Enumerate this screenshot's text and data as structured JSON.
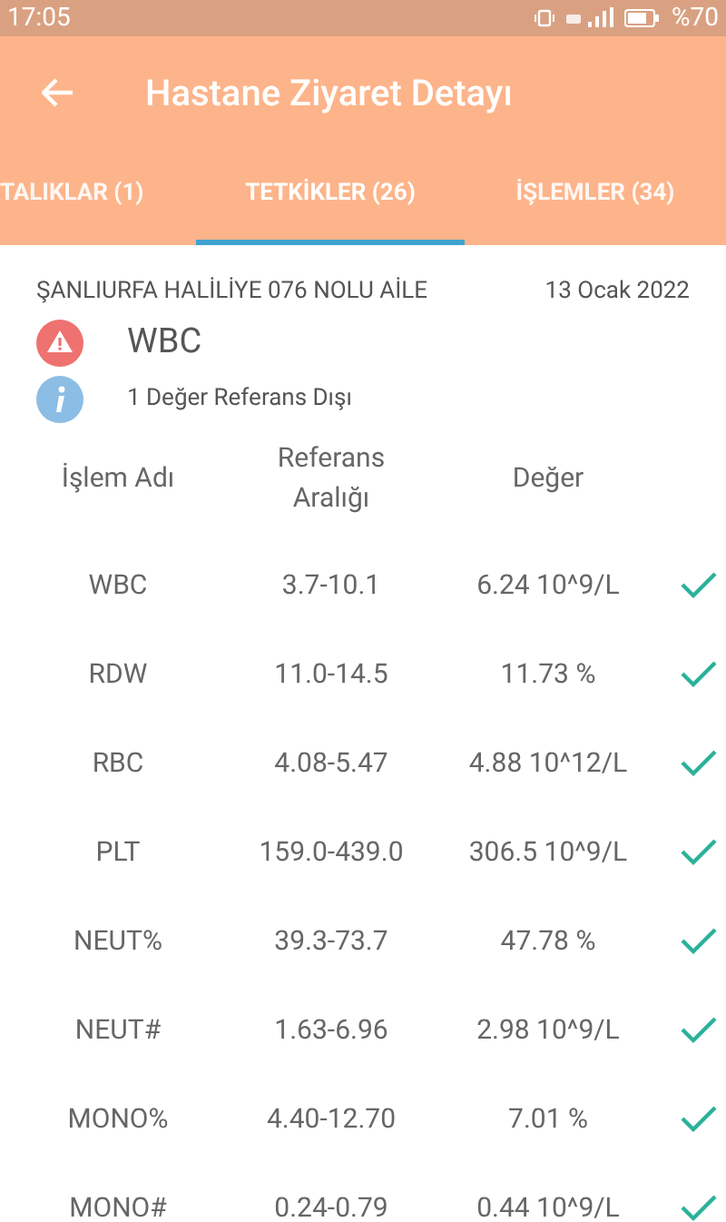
{
  "status_bar": {
    "time": "17:05",
    "battery": "%70"
  },
  "toolbar": {
    "title": "Hastane Ziyaret Detayı"
  },
  "tabs": [
    {
      "label": "TALIKLAR (1)",
      "selected": false
    },
    {
      "label": "TETKİKLER (26)",
      "selected": true
    },
    {
      "label": "İŞLEMLER (34)",
      "selected": false
    }
  ],
  "visit": {
    "facility": "ŞANLIURFA HALİLİYE 076 NOLU AİLE",
    "date": "13 Ocak 2022",
    "warning": "WBC",
    "info": "1 Değer Referans Dışı"
  },
  "table": {
    "columns": [
      "İşlem Adı",
      "Referans Aralığı",
      "Değer"
    ],
    "rows": [
      {
        "name": "WBC",
        "range": "3.7-10.1",
        "value": "6.24 10^9/L",
        "in_range": true
      },
      {
        "name": "RDW",
        "range": "11.0-14.5",
        "value": "11.73 %",
        "in_range": true
      },
      {
        "name": "RBC",
        "range": "4.08-5.47",
        "value": "4.88 10^12/L",
        "in_range": true
      },
      {
        "name": "PLT",
        "range": "159.0-439.0",
        "value": "306.5 10^9/L",
        "in_range": true
      },
      {
        "name": "NEUT%",
        "range": "39.3-73.7",
        "value": "47.78 %",
        "in_range": true
      },
      {
        "name": "NEUT#",
        "range": "1.63-6.96",
        "value": "2.98 10^9/L",
        "in_range": true
      },
      {
        "name": "MONO%",
        "range": "4.40-12.70",
        "value": "7.01 %",
        "in_range": true
      },
      {
        "name": "MONO#",
        "range": "0.24-0.79",
        "value": "0.44 10^9/L",
        "in_range": true
      }
    ]
  }
}
